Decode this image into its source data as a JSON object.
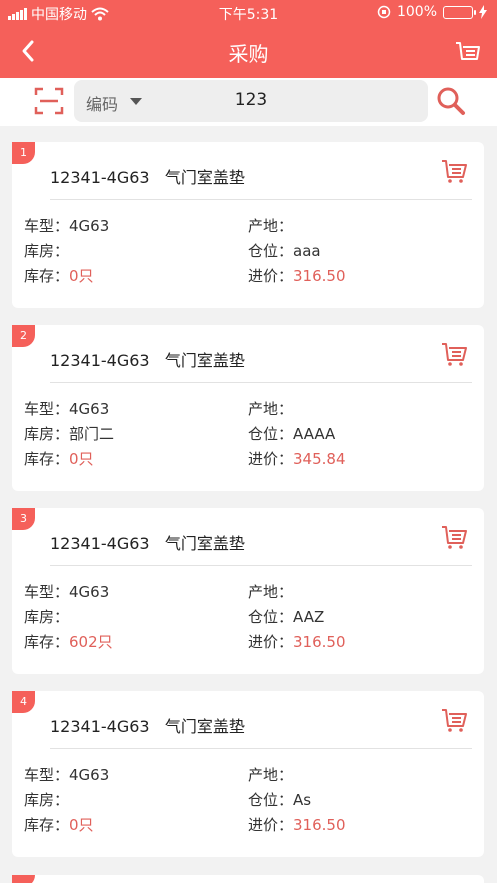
{
  "status_bar": {
    "carrier": "中国移动",
    "time": "下午5:31",
    "battery": "100%"
  },
  "nav": {
    "title": "采购"
  },
  "search": {
    "type": "编码",
    "value": "123"
  },
  "items": [
    {
      "index": "1",
      "code": "12341-4G63",
      "name": "气门室盖垫",
      "model": "4G63",
      "origin": "",
      "warehouse": "",
      "location": "aaa",
      "stock": "0只",
      "price": "316.50"
    },
    {
      "index": "2",
      "code": "12341-4G63",
      "name": "气门室盖垫",
      "model": "4G63",
      "origin": "",
      "warehouse": "部门二",
      "location": "AAAA",
      "stock": "0只",
      "price": "345.84"
    },
    {
      "index": "3",
      "code": "12341-4G63",
      "name": "气门室盖垫",
      "model": "4G63",
      "origin": "",
      "warehouse": "",
      "location": "AAZ",
      "stock": "602只",
      "price": "316.50"
    },
    {
      "index": "4",
      "code": "12341-4G63",
      "name": "气门室盖垫",
      "model": "4G63",
      "origin": "",
      "warehouse": "",
      "location": "As",
      "stock": "0只",
      "price": "316.50"
    }
  ],
  "labels": {
    "model": "车型：",
    "origin": "产地：",
    "warehouse": "库房：",
    "location": "仓位：",
    "stock": "库存：",
    "price": "进价："
  },
  "colors": {
    "brand": "#f5605a",
    "accent_text": "#e0605a"
  },
  "icons": {
    "back": "chevron-left-icon",
    "list": "list-icon",
    "scan": "scan-icon",
    "search": "search-icon",
    "cart": "cart-icon"
  }
}
